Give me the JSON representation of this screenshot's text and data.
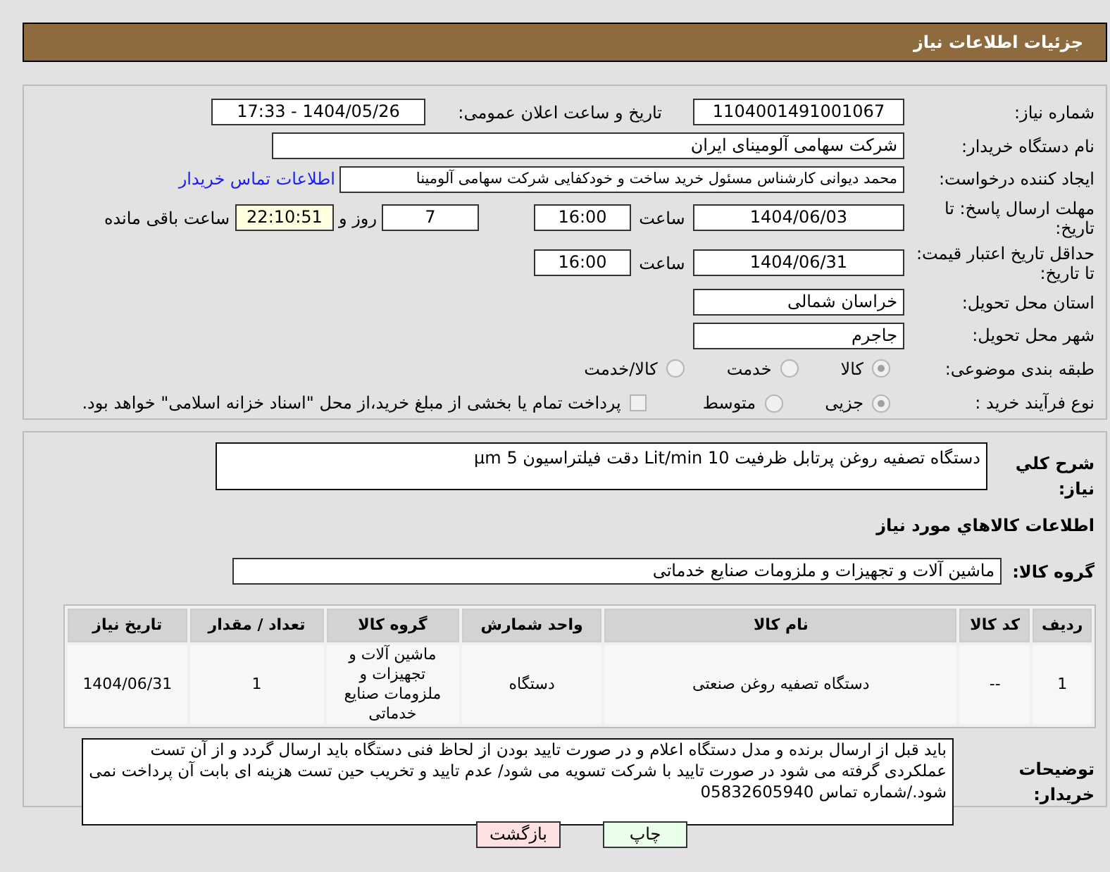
{
  "header": {
    "title": "جزئیات اطلاعات نیاز"
  },
  "need_number": {
    "label": "شماره نیاز:",
    "value": "1104001491001067"
  },
  "announce": {
    "label": "تاریخ و ساعت اعلان عمومی:",
    "value": "1404/05/26 - 17:33"
  },
  "buyer": {
    "label": "نام دستگاه خریدار:",
    "value": "شرکت سهامی آلومینای ایران"
  },
  "creator": {
    "label": "ایجاد کننده درخواست:",
    "value": "محمد دیوانی کارشناس مسئول خرید ساخت و خودکفایی شرکت سهامی آلومینا",
    "link": "اطلاعات تماس خریدار"
  },
  "deadline": {
    "label": "مهلت ارسال پاسخ: تا تاریخ:",
    "date": "1404/06/03",
    "time_label": "ساعت",
    "time": "16:00",
    "days": "7",
    "days_label": "روز و",
    "remaining": "22:10:51",
    "remaining_label": "ساعت باقی مانده"
  },
  "validity": {
    "label": "حداقل تاریخ اعتبار قیمت: تا تاریخ:",
    "date": "1404/06/31",
    "time_label": "ساعت",
    "time": "16:00"
  },
  "province": {
    "label": "استان محل تحویل:",
    "value": "خراسان شمالی"
  },
  "city": {
    "label": "شهر محل تحویل:",
    "value": "جاجرم"
  },
  "category": {
    "label": "طبقه بندی موضوعی:",
    "options": [
      {
        "label": "کالا",
        "selected": true
      },
      {
        "label": "خدمت",
        "selected": false
      },
      {
        "label": "کالا/خدمت",
        "selected": false
      }
    ]
  },
  "process": {
    "label": "نوع فرآیند خرید :",
    "options": [
      {
        "label": "جزیی",
        "selected": true
      },
      {
        "label": "متوسط",
        "selected": false
      }
    ],
    "payment": {
      "label": "پرداخت تمام یا بخشی از مبلغ خرید،از محل \"اسناد خزانه اسلامی\" خواهد بود.",
      "checked": false
    }
  },
  "description": {
    "label": "شرح کلي نياز:",
    "value": "دستگاه تصفیه روغن پرتابل ظرفیت 10 Lit/min دقت فیلتراسیون 5 µm"
  },
  "goods_title": "اطلاعات کالاهاي مورد نياز",
  "goods_group": {
    "label": "گروه کالا:",
    "value": "ماشین آلات و تجهیزات و ملزومات صنایع خدماتی"
  },
  "table": {
    "columns": [
      "ردیف",
      "کد کالا",
      "نام کالا",
      "واحد شمارش",
      "گروه کالا",
      "تعداد / مقدار",
      "تاریخ نیاز"
    ],
    "rows": [
      [
        "1",
        "--",
        "دستگاه تصفیه روغن صنعتی",
        "دستگاه",
        "ماشین آلات و تجهیزات و ملزومات صنایع خدماتی",
        "1",
        "1404/06/31"
      ]
    ]
  },
  "notes": {
    "label": "توضیحات خریدار:",
    "value": "باید قبل از ارسال برنده و مدل دستگاه اعلام و در صورت تایید بودن از لحاظ فنی دستگاه باید ارسال گردد و از آن تست عملکردی گرفته می شود در صورت تایید با شرکت تسویه می شود/ عدم تایید و تخریب حین تست هزینه ای بابت آن پرداخت نمی شود./شماره تماس 05832605940"
  },
  "buttons": [
    {
      "label": "چاپ",
      "kind": "print"
    },
    {
      "label": "بازگشت",
      "kind": "back"
    }
  ]
}
